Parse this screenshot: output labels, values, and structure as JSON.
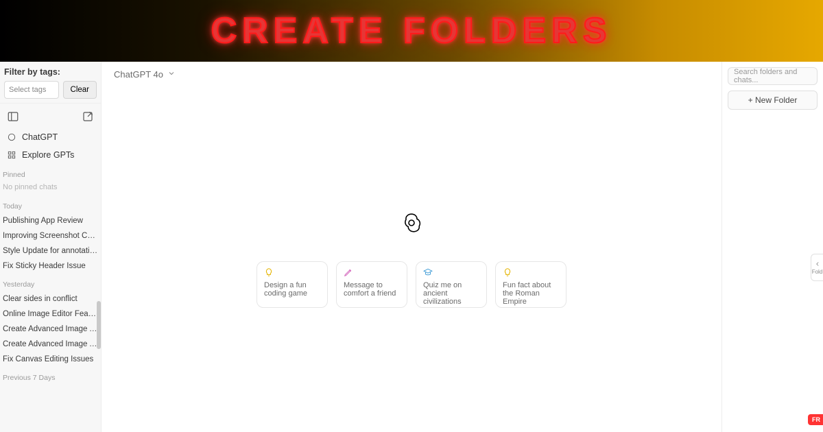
{
  "banner": {
    "title": "CREATE FOLDERS"
  },
  "sidebar": {
    "filter_label": "Filter by tags:",
    "tag_placeholder": "Select tags",
    "clear_label": "Clear",
    "nav": {
      "chatgpt": "ChatGPT",
      "explore": "Explore GPTs"
    },
    "sections": {
      "pinned": {
        "head": "Pinned",
        "empty": "No pinned chats"
      },
      "today": {
        "head": "Today",
        "items": [
          "Publishing App Review",
          "Improving Screenshot Capture Issues",
          "Style Update for annotation.html",
          "Fix Sticky Header Issue"
        ]
      },
      "yesterday": {
        "head": "Yesterday",
        "items": [
          "Clear sides in conflict",
          "Online Image Editor Features",
          "Create Advanced Image Annotator",
          "Create Advanced Image Annotator",
          "Fix Canvas Editing Issues"
        ]
      },
      "prev7": {
        "head": "Previous 7 Days"
      }
    }
  },
  "main": {
    "model_label": "ChatGPT 4o",
    "cards": [
      {
        "text": "Design a fun coding game"
      },
      {
        "text": "Message to comfort a friend"
      },
      {
        "text": "Quiz me on ancient civilizations"
      },
      {
        "text": "Fun fact about the Roman Empire"
      }
    ]
  },
  "right": {
    "search_placeholder": "Search folders and chats...",
    "new_folder_label": "+ New Folder",
    "expand_label": "Fold",
    "badge": "FR"
  }
}
